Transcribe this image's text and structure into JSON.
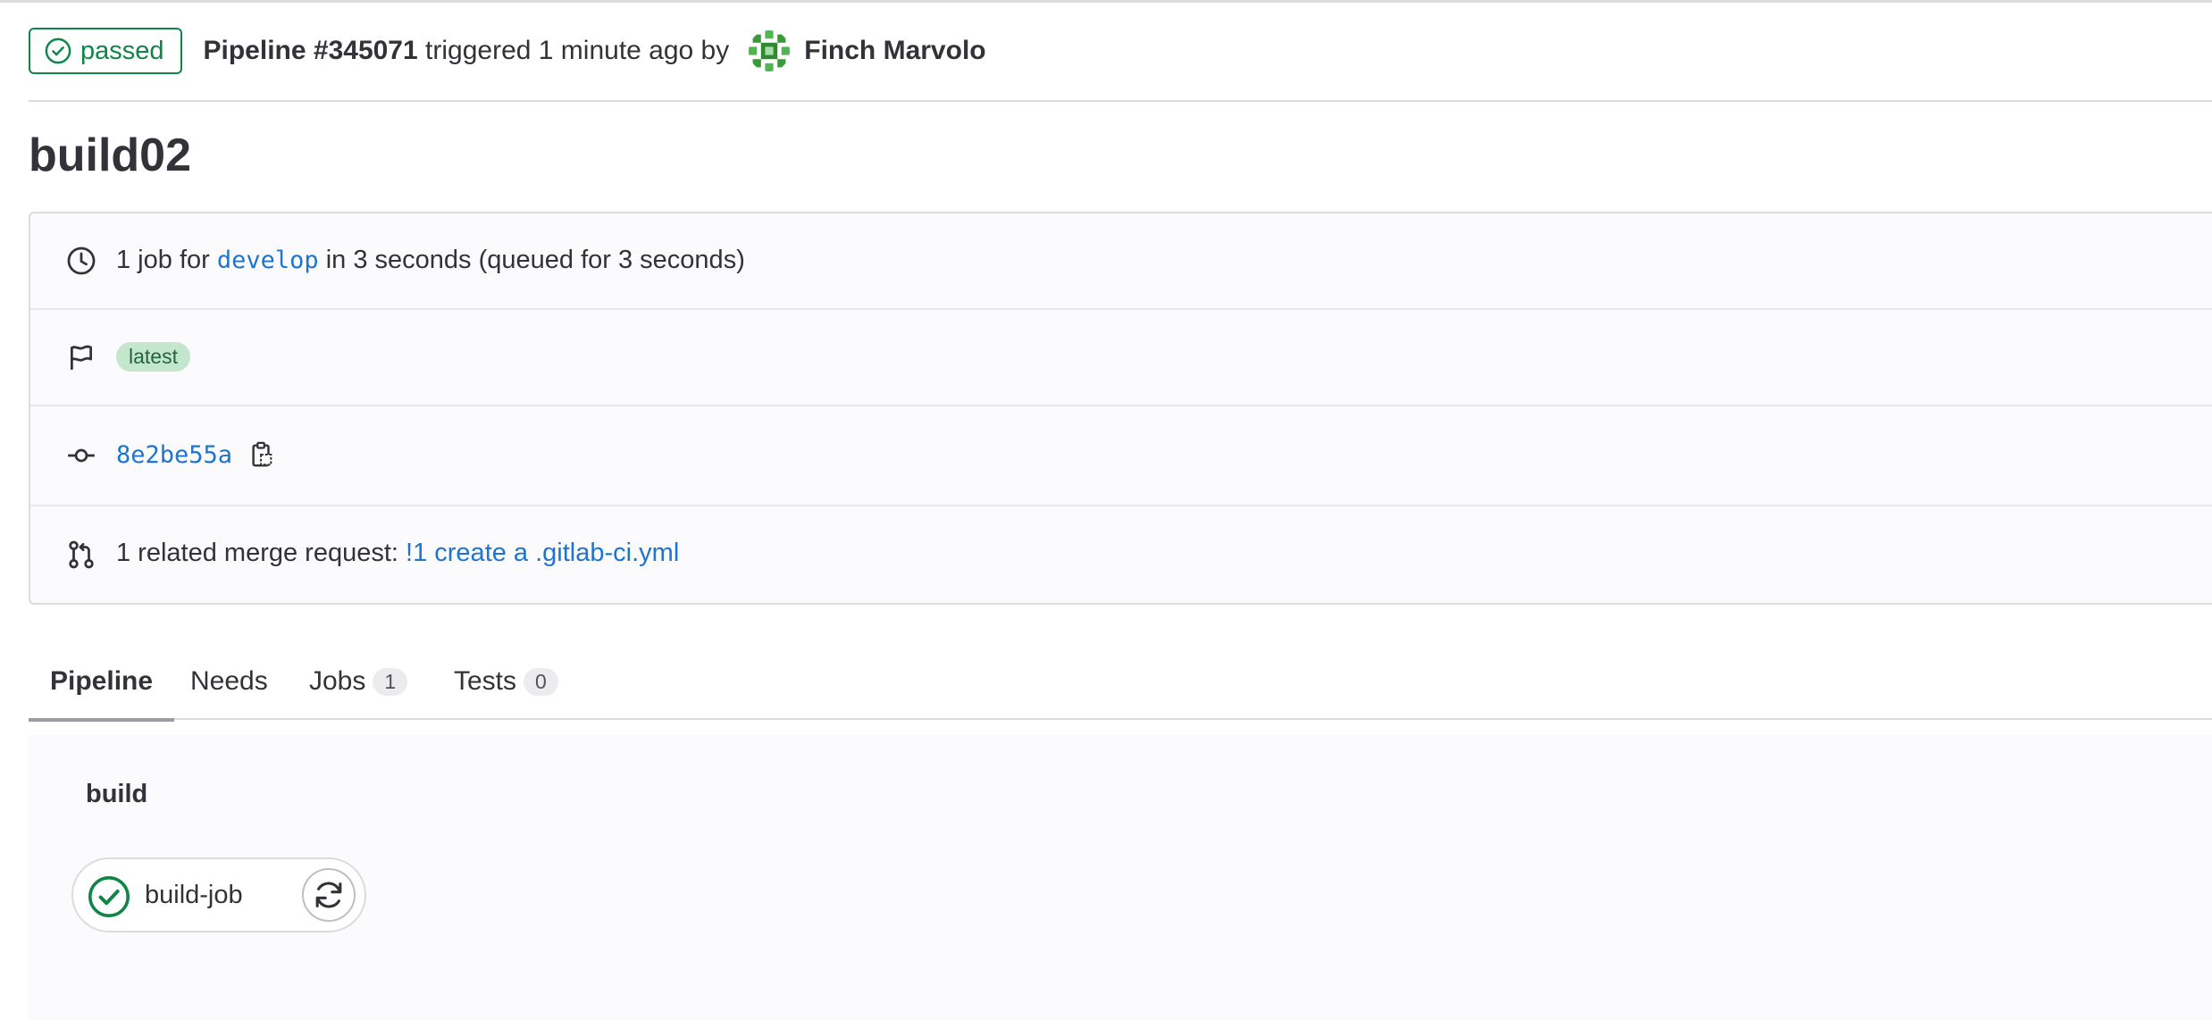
{
  "header": {
    "status_label": "passed",
    "pipeline_id": "Pipeline #345071",
    "triggered_text": "triggered 1 minute ago by",
    "author": "Finch Marvolo"
  },
  "page": {
    "title": "build02"
  },
  "info": {
    "jobs_prefix": "1 job for",
    "branch": "develop",
    "jobs_suffix": "in 3 seconds (queued for 3 seconds)",
    "badge": "latest",
    "commit_sha": "8e2be55a",
    "mr_prefix": "1 related merge request:",
    "mr_link": "!1 create a .gitlab-ci.yml"
  },
  "tabs": [
    {
      "label": "Pipeline",
      "active": true
    },
    {
      "label": "Needs"
    },
    {
      "label": "Jobs",
      "count": "1"
    },
    {
      "label": "Tests",
      "count": "0"
    }
  ],
  "graph": {
    "stage": "build",
    "job": "build-job"
  },
  "colors": {
    "success": "#108548",
    "link": "#1f75cb",
    "badge_bg": "#c3e6cd"
  },
  "icons": {
    "status": "check-circle-icon",
    "duration": "clock-icon",
    "ref": "flag-icon",
    "commit": "commit-icon",
    "copy": "clipboard-icon",
    "merge_request": "merge-request-icon",
    "retry": "retry-icon"
  }
}
